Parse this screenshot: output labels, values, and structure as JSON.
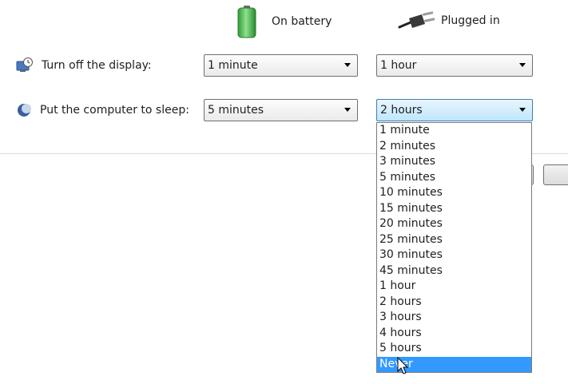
{
  "columns": {
    "battery": {
      "label": "On battery",
      "icon": "battery-icon"
    },
    "plugged": {
      "label": "Plugged in",
      "icon": "power-plug-icon"
    }
  },
  "rows": {
    "display": {
      "label": "Turn off the display:",
      "icon": "monitor-clock-icon",
      "battery_value": "1 minute",
      "plugged_value": "1 hour"
    },
    "sleep": {
      "label": "Put the computer to sleep:",
      "icon": "moon-sleep-icon",
      "battery_value": "5 minutes",
      "plugged_value": "2 hours"
    }
  },
  "dropdown": {
    "options": [
      "1 minute",
      "2 minutes",
      "3 minutes",
      "5 minutes",
      "10 minutes",
      "15 minutes",
      "20 minutes",
      "25 minutes",
      "30 minutes",
      "45 minutes",
      "1 hour",
      "2 hours",
      "3 hours",
      "4 hours",
      "5 hours",
      "Never"
    ],
    "highlighted_index": 15
  },
  "colors": {
    "highlight": "#3399ff",
    "battery_green": "#3cb043",
    "focus_border": "#3c7fb1"
  }
}
